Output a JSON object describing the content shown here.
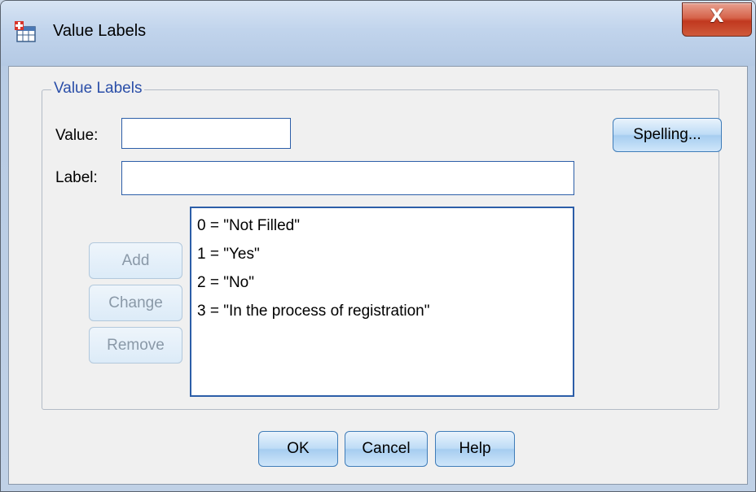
{
  "window": {
    "title": "Value Labels",
    "close_label": "X"
  },
  "group": {
    "legend": "Value Labels"
  },
  "value_field": {
    "label": "Value:",
    "value": ""
  },
  "label_field": {
    "label": "Label:",
    "value": ""
  },
  "buttons": {
    "spelling": "Spelling...",
    "add": "Add",
    "change": "Change",
    "remove": "Remove",
    "ok": "OK",
    "cancel": "Cancel",
    "help": "Help"
  },
  "value_labels": [
    "0 = \"Not Filled\"",
    "1 = \"Yes\"",
    "2 = \"No\"",
    "3 = \"In the process of registration\""
  ],
  "colors": {
    "accent": "#2c5ea8",
    "legend_text": "#2a4ea8",
    "close_button": "#c1381f",
    "button_fill": "#bedcf6"
  },
  "icons": {
    "app": "table-value-labels-icon",
    "close": "close-icon"
  }
}
